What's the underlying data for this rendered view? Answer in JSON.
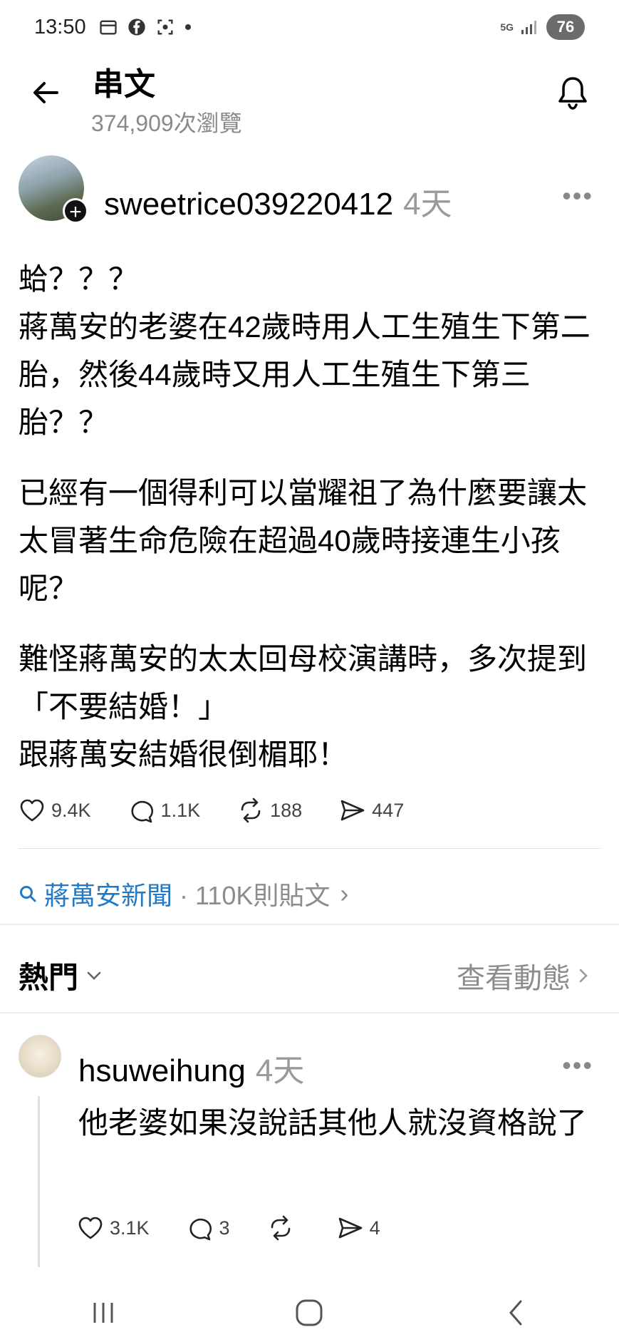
{
  "status_bar": {
    "time": "13:50",
    "battery": "76",
    "network": "5G"
  },
  "header": {
    "title": "串文",
    "views": "374,909次瀏覽"
  },
  "post": {
    "username": "sweetrice039220412",
    "time": "4天",
    "paragraphs": [
      "蛤？？？\n蔣萬安的老婆在42歲時用人工生殖生下第二胎，然後44歲時又用人工生殖生下第三胎？？",
      "已經有一個得利可以當耀祖了為什麼要讓太太冒著生命危險在超過40歲時接連生小孩呢？",
      "難怪蔣萬安的太太回母校演講時，多次提到「不要結婚！」\n跟蔣萬安結婚很倒楣耶！"
    ],
    "likes": "9.4K",
    "comments": "1.1K",
    "reposts": "188",
    "shares": "447"
  },
  "topic": {
    "keyword": "蔣萬安新聞",
    "count": "· 110K則貼文",
    "chevron": "›"
  },
  "sort": {
    "label": "熱門",
    "view_activity": "查看動態"
  },
  "reply": {
    "username": "hsuweihung",
    "time": "4天",
    "text": "他老婆如果沒說話其他人就沒資格說了",
    "likes": "3.1K",
    "comments": "3",
    "reposts": "",
    "shares": "4"
  },
  "icons": {
    "back": "arrow-left-icon",
    "bell": "bell-icon",
    "more": "more-icon",
    "like": "heart-icon",
    "comment": "comment-icon",
    "repost": "repost-icon",
    "share": "send-icon",
    "search": "search-icon"
  }
}
